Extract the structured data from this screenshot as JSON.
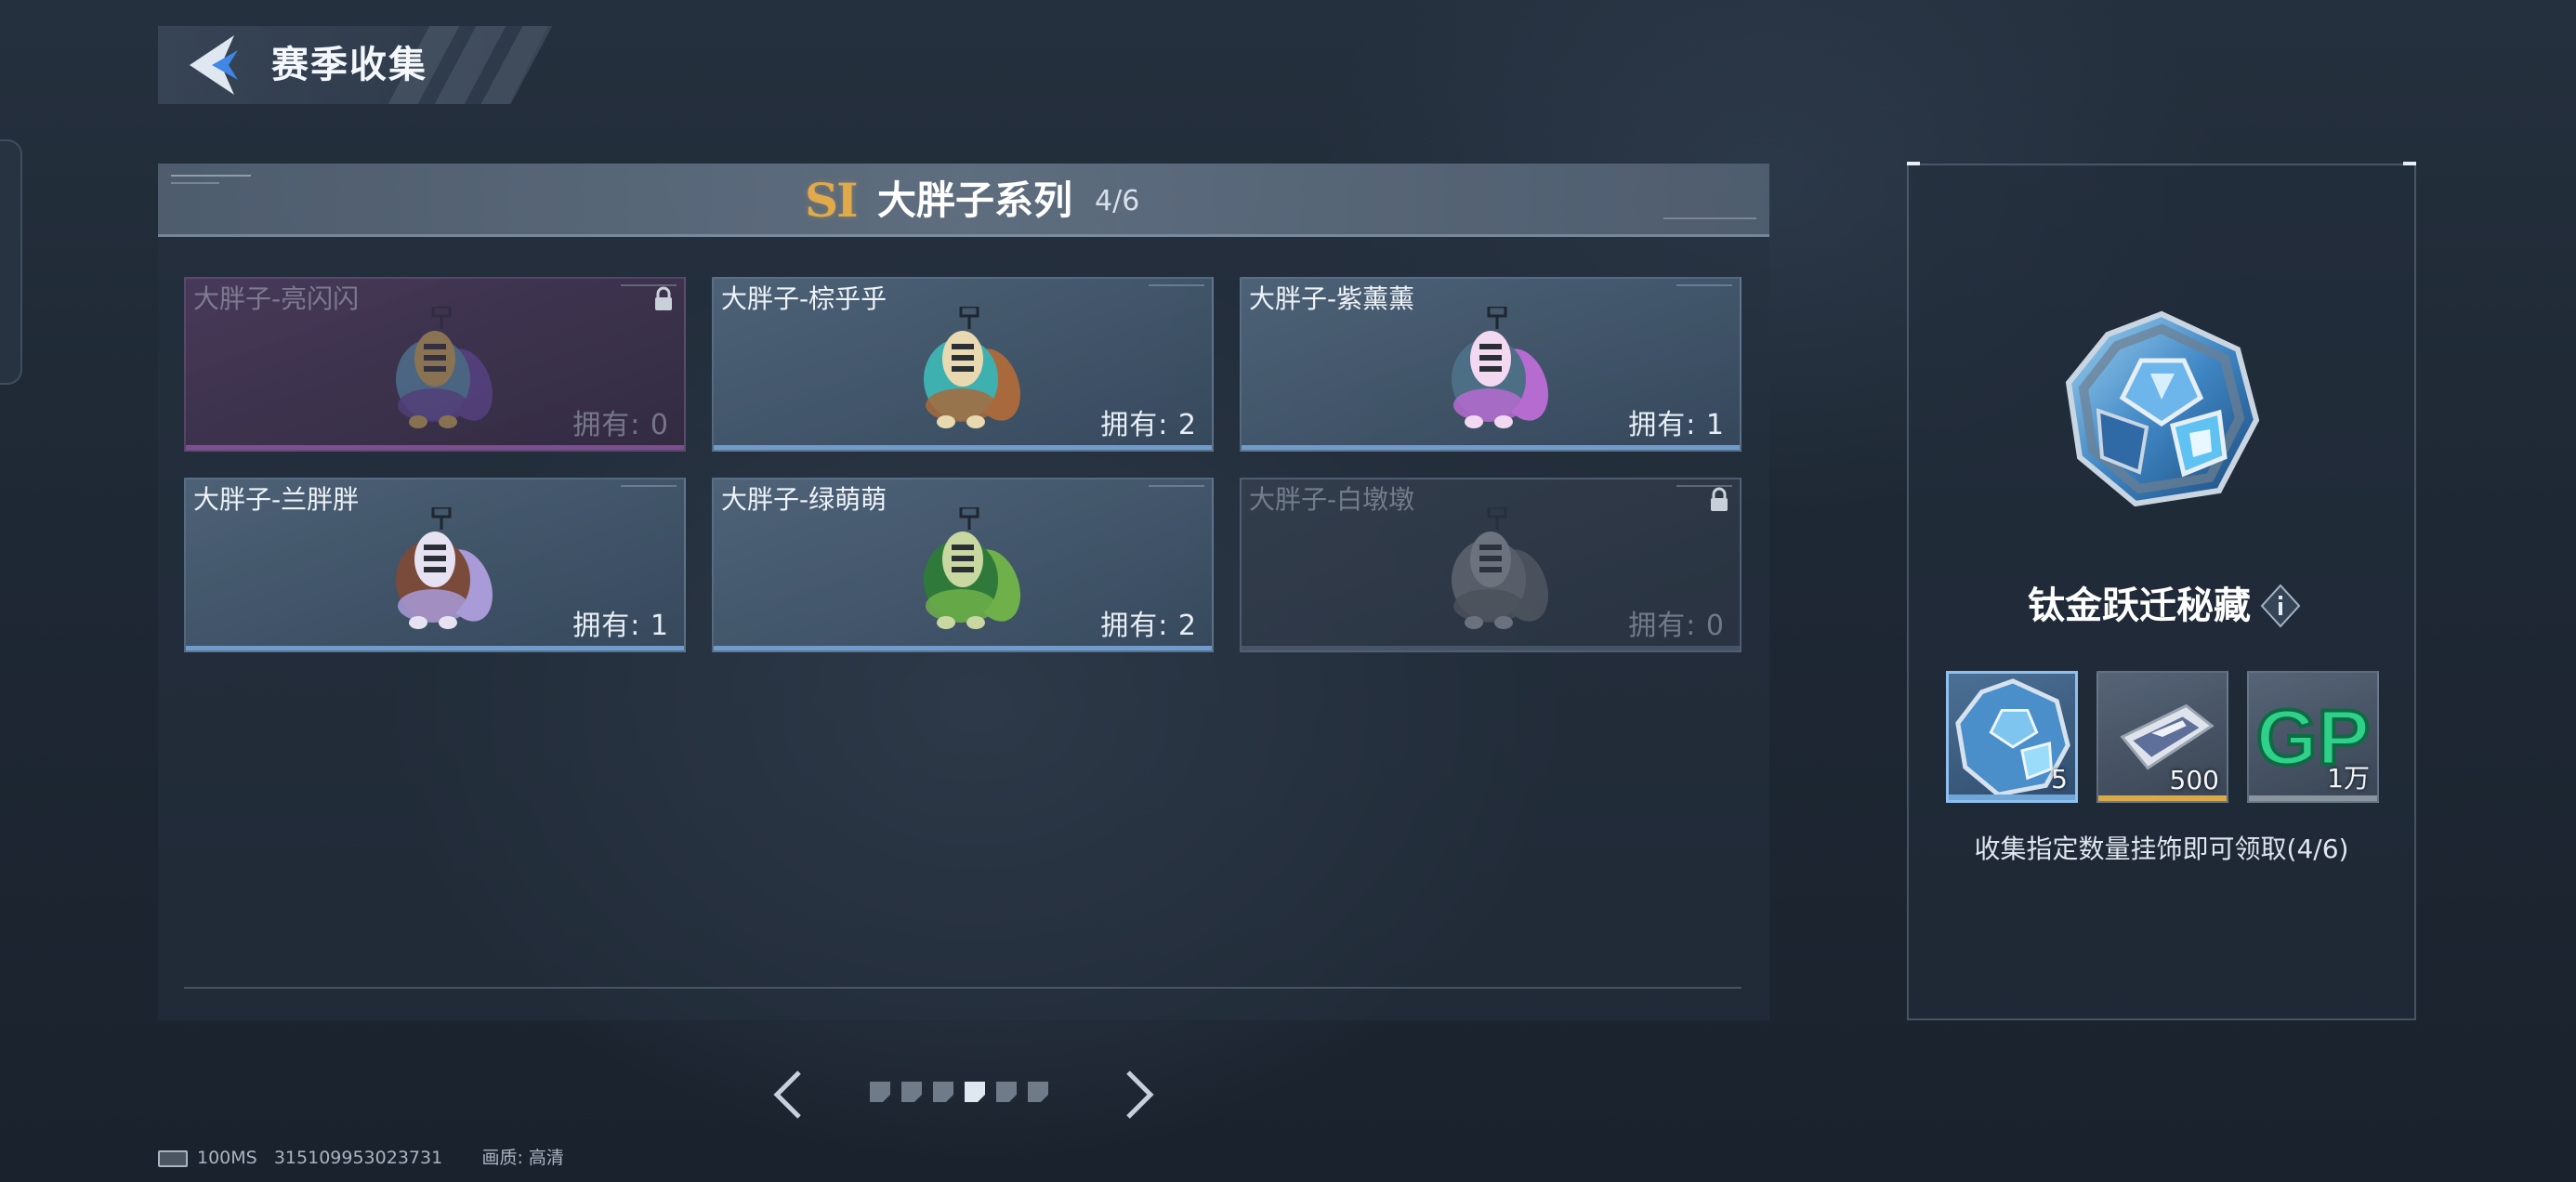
{
  "header": {
    "title": "赛季收集",
    "back_icon": "back-chevron-icon"
  },
  "series": {
    "season_badge": "SI",
    "title": "大胖子系列",
    "progress": "4/6",
    "accent_color": "#e0a94a"
  },
  "cards": [
    {
      "name": "大胖子-亮闪闪",
      "owned": "拥有: 0",
      "locked": true,
      "style": "purple",
      "colors": [
        "#5fa4c4",
        "#6f4fb0",
        "#e6c25a"
      ]
    },
    {
      "name": "大胖子-棕乎乎",
      "owned": "拥有: 2",
      "locked": false,
      "style": "normal",
      "colors": [
        "#3fb0b0",
        "#a86a3c",
        "#e8d9b0"
      ]
    },
    {
      "name": "大胖子-紫薰薰",
      "owned": "拥有: 1",
      "locked": false,
      "style": "normal",
      "colors": [
        "#4c6f86",
        "#b66bd0",
        "#f2d8f0"
      ]
    },
    {
      "name": "大胖子-兰胖胖",
      "owned": "拥有: 1",
      "locked": false,
      "style": "normal",
      "colors": [
        "#7a4a3a",
        "#a99ad8",
        "#e6e2f2"
      ]
    },
    {
      "name": "大胖子-绿萌萌",
      "owned": "拥有: 2",
      "locked": false,
      "style": "normal",
      "colors": [
        "#2f7a3a",
        "#6fb04a",
        "#c8d8a0"
      ]
    },
    {
      "name": "大胖子-白墩墩",
      "owned": "拥有: 0",
      "locked": true,
      "style": "locked",
      "colors": [
        "#8a8f96",
        "#6e7278",
        "#b8bcc2"
      ]
    }
  ],
  "pagination": {
    "total": 6,
    "current": 4
  },
  "reward": {
    "name": "钛金跃迁秘藏",
    "info_icon": "info-icon",
    "items": [
      {
        "qty": "5",
        "icon": "crystal-cube-icon",
        "selected": true,
        "bar_color": "#6fa6d8"
      },
      {
        "qty": "500",
        "icon": "ticket-card-icon",
        "selected": false,
        "bar_color": "#d9a94a"
      },
      {
        "qty": "1万",
        "icon": "gp-coin-icon",
        "selected": false,
        "bar_color": "#8a949e"
      }
    ],
    "description": "收集指定数量挂饰即可领取(4/6)"
  },
  "status": {
    "ping": "100MS",
    "id": "315109953023731",
    "quality": "画质: 高清"
  }
}
